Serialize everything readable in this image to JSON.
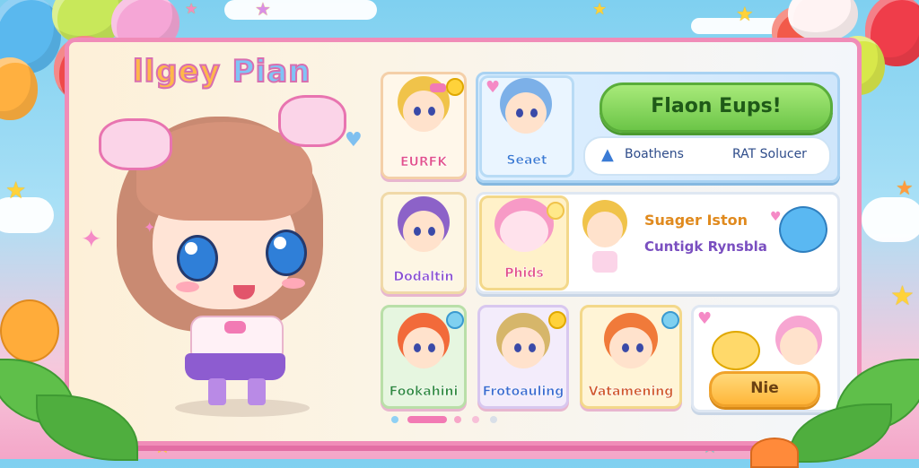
{
  "game": {
    "title_part1": "llgey",
    "title_part2": "Pian"
  },
  "featured": {
    "button_label": "Flaon Eups!",
    "search_left": "Boathens",
    "search_right": "RAT Solucer",
    "search_icon": "triangle-warning-icon"
  },
  "cards": [
    {
      "id": "c1",
      "label": "EURFK",
      "label_color": "#e2508a"
    },
    {
      "id": "c2",
      "label": "Seaet",
      "label_color": "#3a7bd5"
    },
    {
      "id": "c3",
      "label": "Dodaltin",
      "label_color": "#8a4fd0"
    },
    {
      "id": "c4",
      "label": "Phids",
      "label_color": "#e2508a"
    },
    {
      "id": "c5",
      "label": "Fookahini",
      "label_color": "#2f8a3f"
    },
    {
      "id": "c6",
      "label": "Frotoauling",
      "label_color": "#3a6ad0"
    },
    {
      "id": "c7",
      "label": "Vatamening",
      "label_color": "#d0582a"
    }
  ],
  "info_card": {
    "line1": "Suager Iston",
    "line2": "Cuntigk Rynsbla"
  },
  "bottom_card": {
    "button_label": "Nie"
  },
  "pagination": {
    "total": 5,
    "active": 1
  },
  "colors": {
    "panel_border": "#f08cb8",
    "accent_green": "#6cc548",
    "accent_orange": "#ffb63a",
    "title_fill": "#ffb84a",
    "title_stroke": "#d86fb0"
  }
}
